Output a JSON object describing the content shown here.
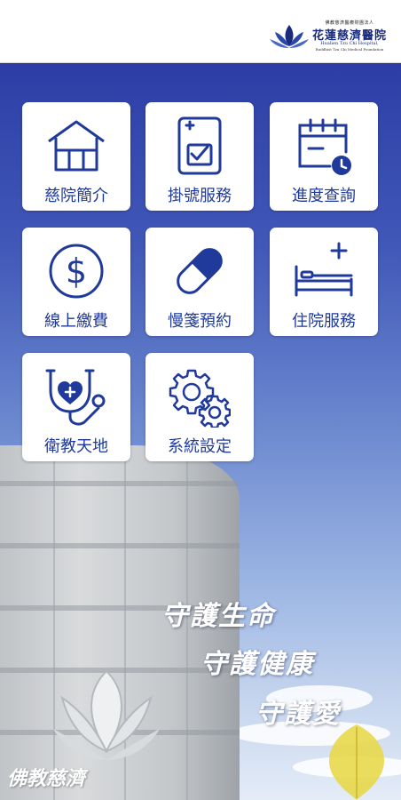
{
  "header": {
    "logo_org_small": "佛教慈濟醫療財團法人",
    "logo_name": "花蓮慈濟醫院",
    "logo_en": "Hualien Tzu Chi Hospital,",
    "logo_en2": "Buddhist Tzu Chi Medical Foundation"
  },
  "menu": [
    {
      "label": "慈院簡介",
      "icon": "house-icon"
    },
    {
      "label": "掛號服務",
      "icon": "clipboard-check-icon"
    },
    {
      "label": "進度查詢",
      "icon": "calendar-clock-icon"
    },
    {
      "label": "線上繳費",
      "icon": "dollar-circle-icon"
    },
    {
      "label": "慢箋預約",
      "icon": "pill-icon"
    },
    {
      "label": "住院服務",
      "icon": "hospital-bed-icon"
    },
    {
      "label": "衛教天地",
      "icon": "stethoscope-heart-icon"
    },
    {
      "label": "系統設定",
      "icon": "gears-icon"
    }
  ],
  "slogans": [
    "守護生命",
    "守護健康",
    "守護愛"
  ],
  "background_text": "佛教慈濟",
  "colors": {
    "accent": "#1f3a9a",
    "background_top": "#2c3ea6",
    "tile": "#ffffff"
  }
}
